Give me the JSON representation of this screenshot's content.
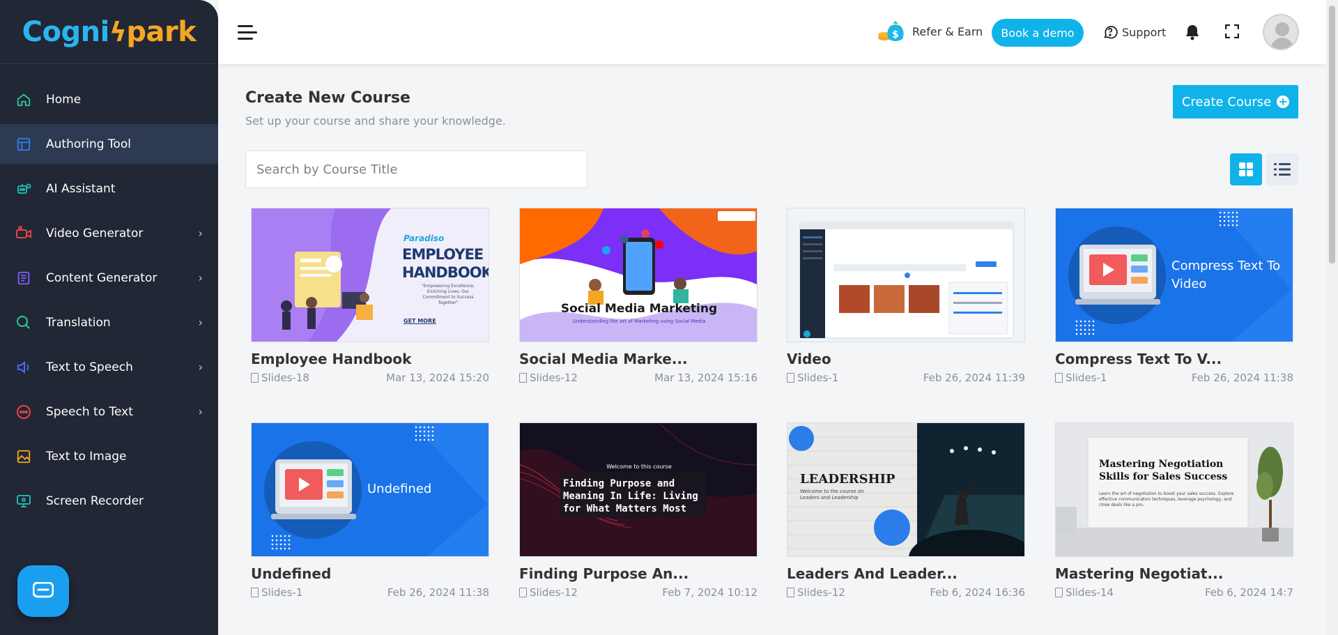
{
  "app": {
    "logo_a": "Cogni",
    "logo_b": "park"
  },
  "sidebar": {
    "items": [
      {
        "label": "Home",
        "icon": "home-icon",
        "chevron": false,
        "color": "#2ecc9a"
      },
      {
        "label": "Authoring Tool",
        "icon": "table-layout-icon",
        "chevron": false,
        "color": "#2f80ed"
      },
      {
        "label": "AI Assistant",
        "icon": "robot-icon",
        "chevron": false,
        "color": "#1fb6a8"
      },
      {
        "label": "Video Generator",
        "icon": "video-camera-icon",
        "chevron": true,
        "color": "#e8424b"
      },
      {
        "label": "Content Generator",
        "icon": "document-lines-icon",
        "chevron": true,
        "color": "#7b61ff"
      },
      {
        "label": "Translation",
        "icon": "chat-bubbles-icon",
        "chevron": true,
        "color": "#2ecc9a"
      },
      {
        "label": "Text to Speech",
        "icon": "speaker-icon",
        "chevron": true,
        "color": "#4a6cf7"
      },
      {
        "label": "Speech to Text",
        "icon": "speech-bubble-icon",
        "chevron": true,
        "color": "#e8424b"
      },
      {
        "label": "Text to Image",
        "icon": "image-icon",
        "chevron": false,
        "color": "#f5a623"
      },
      {
        "label": "Screen Recorder",
        "icon": "monitor-icon",
        "chevron": false,
        "color": "#1fb6a8"
      }
    ],
    "chevron_glyph": "›"
  },
  "topbar": {
    "refer_label": "Refer & Earn",
    "demo_label": "Book a demo",
    "support_label": "Support"
  },
  "page": {
    "title": "Create New Course",
    "subtitle": "Set up your course and share your knowledge.",
    "create_label": "Create Course",
    "create_plus": "+",
    "search_placeholder": "Search by Course Title"
  },
  "courses": [
    {
      "title": "Employee Handbook",
      "slides": "Slides-18",
      "date": "Mar 13, 2024 15:20"
    },
    {
      "title": "Social Media Marke...",
      "slides": "Slides-12",
      "date": "Mar 13, 2024 15:16"
    },
    {
      "title": "Video",
      "slides": "Slides-1",
      "date": "Feb 26, 2024 11:39"
    },
    {
      "title": "Compress Text To V...",
      "slides": "Slides-1",
      "date": "Feb 26, 2024 11:38"
    },
    {
      "title": "Undefined",
      "slides": "Slides-1",
      "date": "Feb 26, 2024 11:38"
    },
    {
      "title": "Finding Purpose An...",
      "slides": "Slides-12",
      "date": "Feb 7, 2024 10:12"
    },
    {
      "title": "Leaders And Leader...",
      "slides": "Slides-12",
      "date": "Feb 6, 2024 16:36"
    },
    {
      "title": "Mastering Negotiat...",
      "slides": "Slides-14",
      "date": "Feb 6, 2024 14:7"
    }
  ],
  "thumbs": {
    "handbook_brand": "Paradiso",
    "handbook_line1": "EMPLOYEE",
    "handbook_line2": "HANDBOOK",
    "handbook_quote": "\"Empowering Excellence, Enriching Lives: Our Commitment to Success Together\"",
    "handbook_cta": "GET MORE",
    "social_title": "Social Media Marketing",
    "social_sub": "Understanding the art of Marketing using Social Media",
    "compress_text": "Compress Text To Video",
    "undefined_text": "Undefined",
    "purpose_welcome": "Welcome to this course",
    "purpose_title": "Finding Purpose and Meaning In Life: Living for What Matters Most",
    "leadership_title": "LEADERSHIP",
    "leadership_sub": "Welcome to the course on Leaders and Leadership",
    "negotiation_title": "Mastering Negotiation Skills for Sales Success",
    "negotiation_body": "Learn the art of negotiation to boost your sales success. Explore effective communication techniques, leverage psychology, and close deals like a pro."
  }
}
